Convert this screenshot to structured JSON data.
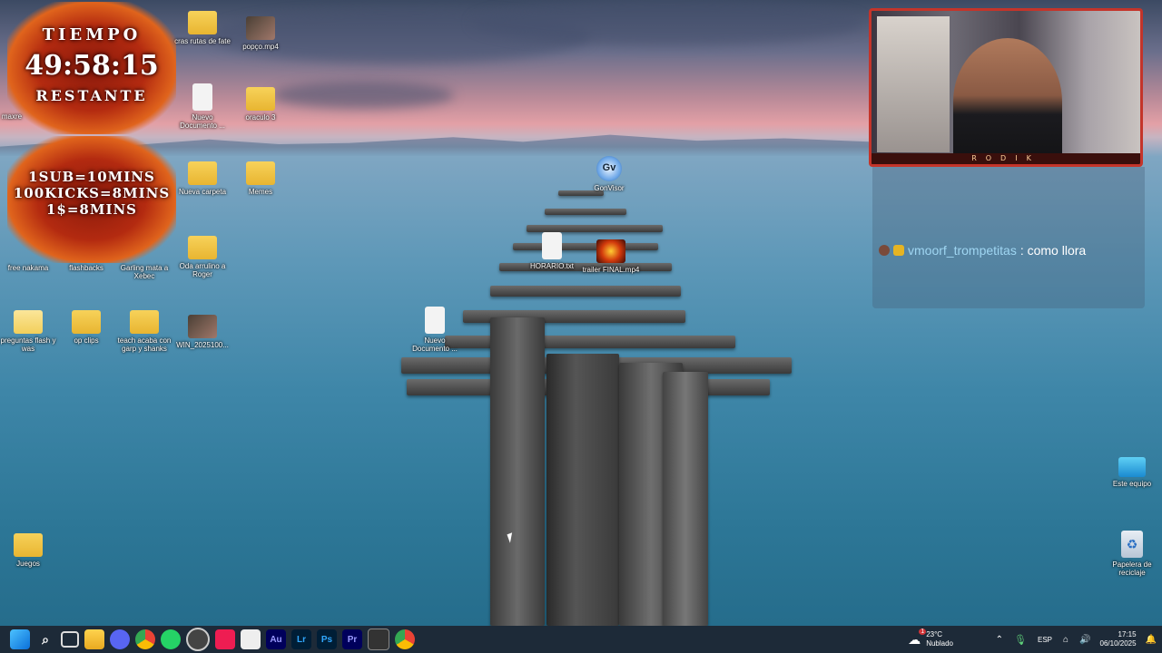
{
  "overlay": {
    "timer_label_top": "TIEMPO",
    "timer_value": "49:58:15",
    "timer_label_bottom": "RESTANTE",
    "rule_1": "1SUB=10MINS",
    "rule_2": "100KICKS=8MINS",
    "rule_3": "1$=8MINS"
  },
  "webcam": {
    "tag": "RODIK"
  },
  "chat": {
    "username": "vmoorf_trompetitas",
    "message": ": como llora"
  },
  "desktop_icons": [
    {
      "label": "cras rutas de fate",
      "type": "folder"
    },
    {
      "label": "popço.mp4",
      "type": "thumb"
    },
    {
      "label": "maxre",
      "type": "thumb"
    },
    {
      "label": "Nuevo Documento ...",
      "type": "doc"
    },
    {
      "label": "oraculo 3",
      "type": "folder"
    },
    {
      "label": "Nueva carpeta",
      "type": "folder"
    },
    {
      "label": "Memes",
      "type": "folder"
    },
    {
      "label": "GonVisor",
      "type": "app"
    },
    {
      "label": "free nakama",
      "type": "folder"
    },
    {
      "label": "flashbacks",
      "type": "folder"
    },
    {
      "label": "Garling mata a Xebec",
      "type": "folder"
    },
    {
      "label": "Oda arrulino a Roger",
      "type": "folder"
    },
    {
      "label": "HORARIO.txt",
      "type": "doc"
    },
    {
      "label": "trailer FINAL.mp4",
      "type": "thumb"
    },
    {
      "label": "preguntas flash y was",
      "type": "folder"
    },
    {
      "label": "op clips",
      "type": "folder"
    },
    {
      "label": "teach acaba con garp y shanks",
      "type": "folder"
    },
    {
      "label": "WIN_2025100...",
      "type": "thumb"
    },
    {
      "label": "Nuevo Documento ...",
      "type": "doc"
    },
    {
      "label": "Juegos",
      "type": "folder"
    },
    {
      "label": "Este equipo",
      "type": "computer"
    },
    {
      "label": "Papelera de reciclaje",
      "type": "recycle"
    }
  ],
  "taskbar": {
    "apps": [
      "windows-start",
      "search",
      "task-view",
      "file-explorer",
      "discord",
      "chrome",
      "whatsapp",
      "obs",
      "tiktok",
      "capcut",
      "audition",
      "lightroom",
      "photoshop",
      "premiere",
      "terminal",
      "chrome-active"
    ],
    "app_labels": {
      "audition": "Au",
      "lightroom": "Lr",
      "photoshop": "Ps",
      "premiere": "Pr"
    },
    "weather_temp": "23°C",
    "weather_desc": "Nublado",
    "weather_badge": "1",
    "language": "ESP",
    "time": "17:15",
    "date": "06/10/2025"
  }
}
